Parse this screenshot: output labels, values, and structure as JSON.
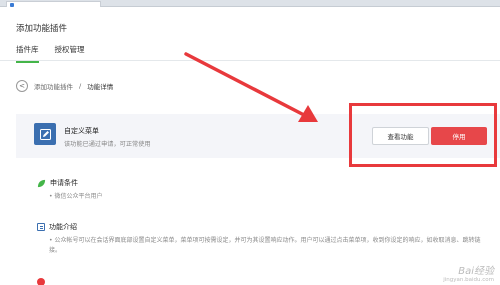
{
  "browser": {
    "tab_title": ""
  },
  "page": {
    "title": "添加功能插件"
  },
  "tabs": [
    {
      "label": "插件库",
      "active": true
    },
    {
      "label": "授权管理",
      "active": false
    }
  ],
  "breadcrumb": {
    "back_glyph": "<",
    "parent": "添加功能插件",
    "separator": "/",
    "current": "功能详情"
  },
  "plugin": {
    "name": "自定义菜单",
    "description": "该功能已通过申请，可正常使用",
    "view_button": "查看功能",
    "disable_button": "停用"
  },
  "sections": {
    "conditions": {
      "title": "申请条件",
      "bullet": "•",
      "text": "微信公众平台用户"
    },
    "intro": {
      "title": "功能介绍",
      "bullet": "•",
      "text": "公众帐号可以在会话界面底部设置自定义菜单，菜单项可按需设定，并可为其设置响应动作。用户可以通过点击菜单项，收到你设定的响应，如收取消息、跳转链接。"
    },
    "next": {
      "title": ""
    }
  },
  "watermark": {
    "logo": "Bai经验",
    "url": "jingyan.baidu.com"
  },
  "colors": {
    "tab_underline": "#44b549",
    "disable_button": "#e7474a",
    "annotation_red": "#e8393c",
    "plugin_icon": "#3b6fb0",
    "leaf_icon": "#44b549"
  },
  "icons": {
    "back": "chevron-left-circle-icon",
    "plugin": "edit-pencil-icon",
    "conditions": "leaf-icon",
    "intro": "document-icon",
    "next": "alert-dot-icon"
  }
}
